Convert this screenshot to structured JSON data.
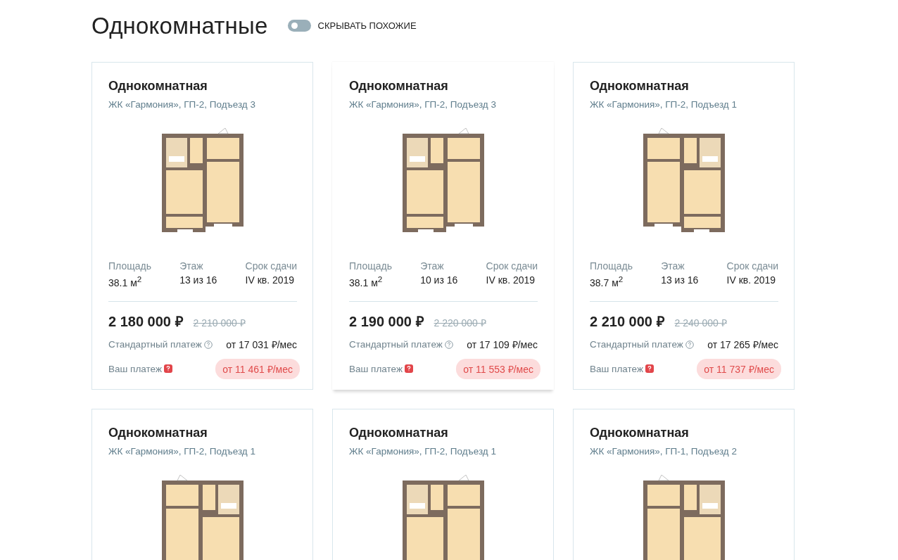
{
  "heading": "Однокомнатные",
  "toggle": {
    "label": "СКРЫВАТЬ ПОХОЖИЕ",
    "on": false
  },
  "cards": [
    {
      "title": "Однокомнатная",
      "subtitle": "ЖК «Гармония», ГП-2, Подъезд 3",
      "hovered": false,
      "plan_mirrored": false,
      "specs": [
        {
          "label": "Площадь",
          "value": "38.1 м$^{2}$"
        },
        {
          "label": "Этаж",
          "value": "13 из 16"
        },
        {
          "label": "Срок сдачи",
          "value": "IV кв. 2019"
        }
      ],
      "price": "2 180 000 ₽",
      "old_price": "2 210 000 ₽",
      "standard_label": "Стандартный платеж",
      "standard_value": "от 17 031 ₽/мес",
      "your_label": "Ваш платеж",
      "your_value": "от 11 461 ₽/мес"
    },
    {
      "title": "Однокомнатная",
      "subtitle": "ЖК «Гармония», ГП-2, Подъезд 3",
      "hovered": true,
      "plan_mirrored": false,
      "specs": [
        {
          "label": "Площадь",
          "value": "38.1 м$^{2}$"
        },
        {
          "label": "Этаж",
          "value": "10 из 16"
        },
        {
          "label": "Срок сдачи",
          "value": "IV кв. 2019"
        }
      ],
      "price": "2 190 000 ₽",
      "old_price": "2 220 000 ₽",
      "standard_label": "Стандартный платеж",
      "standard_value": "от 17 109 ₽/мес",
      "your_label": "Ваш платеж",
      "your_value": "от 11 553 ₽/мес"
    },
    {
      "title": "Однокомнатная",
      "subtitle": "ЖК «Гармония», ГП-2, Подъезд 1",
      "hovered": false,
      "plan_mirrored": true,
      "specs": [
        {
          "label": "Площадь",
          "value": "38.7 м$^{2}$"
        },
        {
          "label": "Этаж",
          "value": "13 из 16"
        },
        {
          "label": "Срок сдачи",
          "value": "IV кв. 2019"
        }
      ],
      "price": "2 210 000 ₽",
      "old_price": "2 240 000 ₽",
      "standard_label": "Стандартный платеж",
      "standard_value": "от 17 265 ₽/мес",
      "your_label": "Ваш платеж",
      "your_value": "от 11 737 ₽/мес"
    },
    {
      "title": "Однокомнатная",
      "subtitle": "ЖК «Гармония», ГП-2, Подъезд 1",
      "hovered": false,
      "plan_mirrored": true
    },
    {
      "title": "Однокомнатная",
      "subtitle": "ЖК «Гармония», ГП-2, Подъезд 1",
      "hovered": false,
      "plan_mirrored": false
    },
    {
      "title": "Однокомнатная",
      "subtitle": "ЖК «Гармония», ГП-1, Подъезд 2",
      "hovered": false,
      "plan_mirrored": true
    }
  ]
}
